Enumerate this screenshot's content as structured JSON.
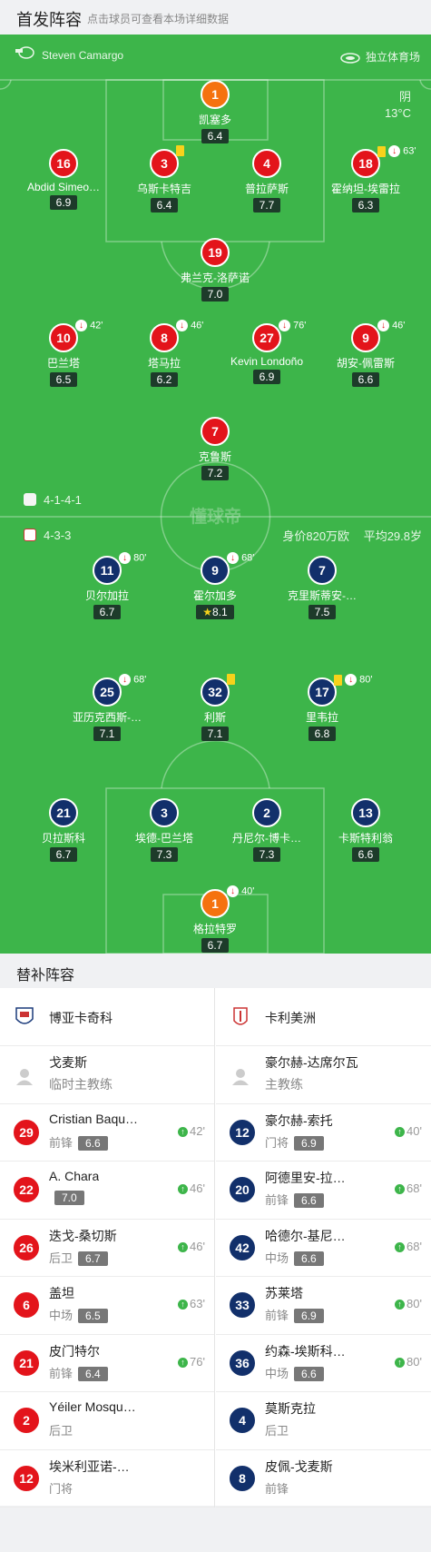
{
  "header": {
    "title": "首发阵容",
    "subtitle": "点击球员可查看本场详细数据"
  },
  "match": {
    "referee": "Steven Camargo",
    "venue": "独立体育场",
    "weather": "阴",
    "temperature": "13°C",
    "watermark": "懂球帝"
  },
  "home": {
    "formation": "4-1-4-1",
    "players": [
      {
        "num": "1",
        "name": "凯塞多",
        "rating": "6.4",
        "gk": true
      },
      {
        "num": "16",
        "name": "Abdid Simeo…",
        "rating": "6.9"
      },
      {
        "num": "3",
        "name": "乌斯卡特吉",
        "rating": "6.4",
        "yellow": true
      },
      {
        "num": "4",
        "name": "普拉萨斯",
        "rating": "7.7"
      },
      {
        "num": "18",
        "name": "霍纳坦-埃雷拉",
        "rating": "6.3",
        "yellow": true,
        "sub": "63'"
      },
      {
        "num": "19",
        "name": "弗兰克-洛萨诺",
        "rating": "7.0",
        "captain": true
      },
      {
        "num": "10",
        "name": "巴兰塔",
        "rating": "6.5",
        "sub": "42'"
      },
      {
        "num": "8",
        "name": "塔马拉",
        "rating": "6.2",
        "sub": "46'"
      },
      {
        "num": "27",
        "name": "Kevin Londoño",
        "rating": "6.9",
        "sub": "76'"
      },
      {
        "num": "9",
        "name": "胡安-佩雷斯",
        "rating": "6.6",
        "sub": "46'"
      },
      {
        "num": "7",
        "name": "克鲁斯",
        "rating": "7.2"
      }
    ]
  },
  "away": {
    "formation": "4-3-3",
    "value": "身价820万欧",
    "avg_age": "平均29.8岁",
    "players": [
      {
        "num": "11",
        "name": "贝尔加拉",
        "rating": "6.7",
        "sub": "80'"
      },
      {
        "num": "9",
        "name": "霍尔加多",
        "rating": "8.1",
        "sub": "68'",
        "goal": true,
        "star": true
      },
      {
        "num": "7",
        "name": "克里斯蒂安-…",
        "rating": "7.5",
        "goal": true
      },
      {
        "num": "25",
        "name": "亚历克西斯-…",
        "rating": "7.1",
        "sub": "68'"
      },
      {
        "num": "32",
        "name": "利斯",
        "rating": "7.1",
        "yellow": true
      },
      {
        "num": "17",
        "name": "里韦拉",
        "rating": "6.8",
        "yellow": true,
        "sub": "80'"
      },
      {
        "num": "21",
        "name": "贝拉斯科",
        "rating": "6.7"
      },
      {
        "num": "3",
        "name": "埃德-巴兰塔",
        "rating": "7.3"
      },
      {
        "num": "2",
        "name": "丹尼尔-博卡…",
        "rating": "7.3"
      },
      {
        "num": "13",
        "name": "卡斯特利翁",
        "rating": "6.6"
      },
      {
        "num": "1",
        "name": "格拉特罗",
        "rating": "6.7",
        "gk": true,
        "captain": true,
        "sub": "40'"
      }
    ]
  },
  "subs": {
    "title": "替补阵容",
    "home_team": "博亚卡奇科",
    "away_team": "卡利美洲",
    "home_coach": {
      "name": "戈麦斯",
      "role": "临时主教练"
    },
    "away_coach": {
      "name": "豪尔赫-达席尔瓦",
      "role": "主教练"
    },
    "home": [
      {
        "num": "29",
        "name": "Cristian Baqu…",
        "pos": "前锋",
        "rating": "6.6",
        "min": "42'"
      },
      {
        "num": "22",
        "name": "A. Chara",
        "pos": "",
        "rating": "7.0",
        "min": "46'"
      },
      {
        "num": "26",
        "name": "迭戈-桑切斯",
        "pos": "后卫",
        "rating": "6.7",
        "min": "46'"
      },
      {
        "num": "6",
        "name": "盖坦",
        "pos": "中场",
        "rating": "6.5",
        "min": "63'"
      },
      {
        "num": "21",
        "name": "皮门特尔",
        "pos": "前锋",
        "rating": "6.4",
        "min": "76'"
      },
      {
        "num": "2",
        "name": "Yéiler Mosqu…",
        "pos": "后卫",
        "rating": "",
        "min": ""
      },
      {
        "num": "12",
        "name": "埃米利亚诺-…",
        "pos": "门将",
        "rating": "",
        "min": ""
      }
    ],
    "away": [
      {
        "num": "12",
        "name": "豪尔赫-索托",
        "pos": "门将",
        "rating": "6.9",
        "min": "40'"
      },
      {
        "num": "20",
        "name": "阿德里安-拉…",
        "pos": "前锋",
        "rating": "6.6",
        "min": "68'"
      },
      {
        "num": "42",
        "name": "哈德尔-基尼…",
        "pos": "中场",
        "rating": "6.6",
        "min": "68'"
      },
      {
        "num": "33",
        "name": "苏莱塔",
        "pos": "前锋",
        "rating": "6.9",
        "min": "80'"
      },
      {
        "num": "36",
        "name": "约森-埃斯科…",
        "pos": "中场",
        "rating": "6.6",
        "min": "80'"
      },
      {
        "num": "4",
        "name": "莫斯克拉",
        "pos": "后卫",
        "rating": "",
        "min": ""
      },
      {
        "num": "8",
        "name": "皮佩-戈麦斯",
        "pos": "前锋",
        "rating": "",
        "min": ""
      }
    ]
  }
}
